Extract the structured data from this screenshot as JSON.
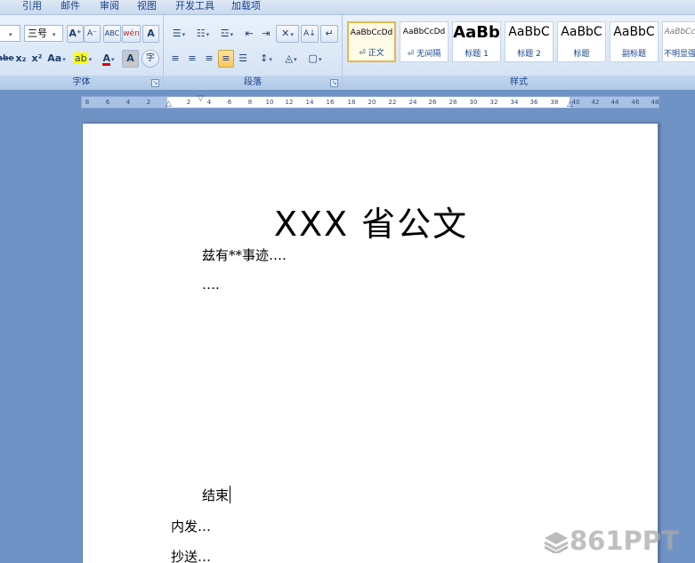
{
  "menu_tabs": [
    "引用",
    "邮件",
    "审阅",
    "视图",
    "开发工具",
    "加载项"
  ],
  "font_group": {
    "label": "字体",
    "font_size": "三号",
    "grow_font": "A⁺",
    "shrink_font": "A⁻",
    "clear_format": "ABC",
    "phonetic": "wén",
    "char_border": "A",
    "strikethrough": "abe",
    "subscript": "x₂",
    "superscript": "x²",
    "change_case": "Aa",
    "highlight": "ab",
    "font_color": "A",
    "char_shading": "A",
    "enclose": "字"
  },
  "paragraph_group": {
    "label": "段落",
    "bullets": "☰",
    "numbering": "☷",
    "multilevel": "☲",
    "decrease_indent": "⇤",
    "increase_indent": "⇥",
    "chinese_layout": "✕",
    "sort": "A↓",
    "show_marks": "↵",
    "align_left": "≡",
    "align_center": "≡",
    "align_right": "≡",
    "justify": "≡",
    "distributed": "☰",
    "line_spacing": "↕",
    "shading": "◬",
    "borders": "▢"
  },
  "styles_group": {
    "label": "样式",
    "items": [
      {
        "sample": "AaBbCcDd",
        "name": "⏎ 正文"
      },
      {
        "sample": "AaBbCcDd",
        "name": "⏎ 无间隔"
      },
      {
        "sample": "AaBb",
        "name": "标题 1"
      },
      {
        "sample": "AaBbC",
        "name": "标题 2"
      },
      {
        "sample": "AaBbC",
        "name": "标题"
      },
      {
        "sample": "AaBbC",
        "name": "副标题"
      },
      {
        "sample": "AaBbCc",
        "name": "不明显强"
      }
    ]
  },
  "ruler": {
    "ticks": [
      "8",
      "6",
      "4",
      "2",
      "2",
      "4",
      "6",
      "8",
      "10",
      "12",
      "14",
      "16",
      "18",
      "20",
      "22",
      "24",
      "26",
      "28",
      "30",
      "32",
      "34",
      "36",
      "38",
      "40",
      "42",
      "44",
      "46",
      "48"
    ]
  },
  "document": {
    "title": "XXX 省公文",
    "line1": "兹有**事迹….",
    "line2": "….",
    "line_end": "结束",
    "line_internal": "内发…",
    "line_cc": "抄送…"
  },
  "watermark": {
    "text": "861PPT"
  }
}
